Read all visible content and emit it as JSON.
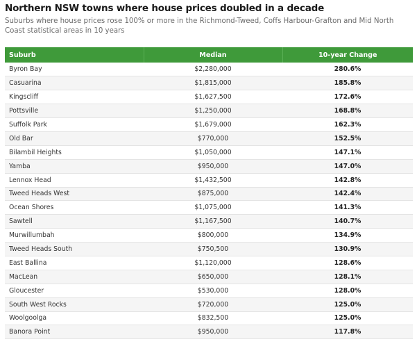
{
  "chart_data": {
    "type": "table",
    "title": "Northern NSW towns where house prices doubled in a decade",
    "subtitle": "Suburbs where house prices rose 100% or more in the Richmond-Tweed, Coffs Harbour-Grafton and Mid North Coast statistical areas in 10 years",
    "columns": [
      "Suburb",
      "Median",
      "10-year Change"
    ],
    "header_color": "#3f9a3a",
    "rows": [
      {
        "suburb": "Byron Bay",
        "median": "$2,280,000",
        "change": "280.6%"
      },
      {
        "suburb": "Casuarina",
        "median": "$1,815,000",
        "change": "185.8%"
      },
      {
        "suburb": "Kingscliff",
        "median": "$1,627,500",
        "change": "172.6%"
      },
      {
        "suburb": "Pottsville",
        "median": "$1,250,000",
        "change": "168.8%"
      },
      {
        "suburb": "Suffolk Park",
        "median": "$1,679,000",
        "change": "162.3%"
      },
      {
        "suburb": "Old Bar",
        "median": "$770,000",
        "change": "152.5%"
      },
      {
        "suburb": "Bilambil Heights",
        "median": "$1,050,000",
        "change": "147.1%"
      },
      {
        "suburb": "Yamba",
        "median": "$950,000",
        "change": "147.0%"
      },
      {
        "suburb": "Lennox Head",
        "median": "$1,432,500",
        "change": "142.8%"
      },
      {
        "suburb": "Tweed Heads West",
        "median": "$875,000",
        "change": "142.4%"
      },
      {
        "suburb": "Ocean Shores",
        "median": "$1,075,000",
        "change": "141.3%"
      },
      {
        "suburb": "Sawtell",
        "median": "$1,167,500",
        "change": "140.7%"
      },
      {
        "suburb": "Murwillumbah",
        "median": "$800,000",
        "change": "134.9%"
      },
      {
        "suburb": "Tweed Heads South",
        "median": "$750,500",
        "change": "130.9%"
      },
      {
        "suburb": "East Ballina",
        "median": "$1,120,000",
        "change": "128.6%"
      },
      {
        "suburb": "MacLean",
        "median": "$650,000",
        "change": "128.1%"
      },
      {
        "suburb": "Gloucester",
        "median": "$530,000",
        "change": "128.0%"
      },
      {
        "suburb": "South West Rocks",
        "median": "$720,000",
        "change": "125.0%"
      },
      {
        "suburb": "Woolgoolga",
        "median": "$832,500",
        "change": "125.0%"
      },
      {
        "suburb": "Banora Point",
        "median": "$950,000",
        "change": "117.8%"
      }
    ]
  }
}
